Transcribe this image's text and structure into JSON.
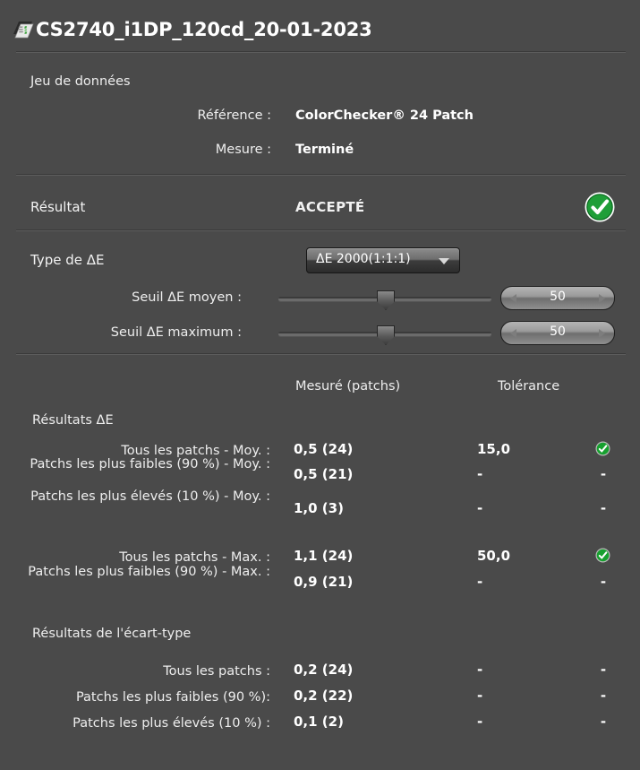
{
  "window": {
    "title": "CS2740_i1DP_120cd_20-01-2023",
    "title_icon": "document-color-patches-icon",
    "bg_color": "#4a4a4a"
  },
  "dataset": {
    "section_label": "Jeu de données",
    "rows": [
      {
        "label": "Référence :",
        "value": "ColorChecker® 24 Patch"
      },
      {
        "label": "Mesure :",
        "value": "Terminé"
      }
    ]
  },
  "result": {
    "label": "Résultat",
    "value": "ACCEPTÉ",
    "status_icon": "check-circle-icon",
    "status_color": "#21a33c"
  },
  "delta_e": {
    "label": "Type de ΔE",
    "combo": {
      "selected": "ΔE 2000(1:1:1)",
      "arrow_icon": "chevron-down-icon"
    },
    "sliders": [
      {
        "label": "Seuil ΔE moyen :",
        "value": "50",
        "thumb_pct": 50,
        "left_arrow_icon": "triangle-left-icon",
        "right_arrow_icon": "triangle-right-icon"
      },
      {
        "label": "Seuil ΔE maximum :",
        "value": "50",
        "thumb_pct": 50,
        "left_arrow_icon": "triangle-left-icon",
        "right_arrow_icon": "triangle-right-icon"
      }
    ]
  },
  "results_table": {
    "columns": {
      "measured": "Mesuré (patchs)",
      "tolerance": "Tolérance"
    },
    "groups": [
      {
        "heading": "Résultats ΔE",
        "rows": [
          {
            "label": "Tous les patchs - Moy. :",
            "measured": "0,5  (24)",
            "tolerance": "15,0",
            "status": "ok"
          },
          {
            "label": "Patchs les plus faibles (90 %) - Moy. :",
            "measured": "0,5  (21)",
            "tolerance": "-",
            "status": "-"
          },
          {
            "label": "Patchs les plus élevés (10 %) - Moy. :",
            "measured": "1,0  (3)",
            "tolerance": "-",
            "status": "-"
          },
          {
            "label": "Tous les patchs - Max. :",
            "measured": "1,1   (24)",
            "tolerance": "50,0",
            "status": "ok"
          },
          {
            "label": "Patchs les plus faibles (90 %) - Max. :",
            "measured": "0,9  (21)",
            "tolerance": "-",
            "status": "-"
          }
        ]
      },
      {
        "heading": "Résultats de l'écart-type",
        "rows": [
          {
            "label": "Tous les patchs :",
            "measured": "0,2  (24)",
            "tolerance": "-",
            "status": "-"
          },
          {
            "label": "Patchs les plus faibles (90 %):",
            "measured": "0,2  (22)",
            "tolerance": "-",
            "status": "-"
          },
          {
            "label": "Patchs les plus élevés (10 %) :",
            "measured": "0,1 (2)",
            "tolerance": "-",
            "status": "-"
          }
        ]
      }
    ]
  }
}
